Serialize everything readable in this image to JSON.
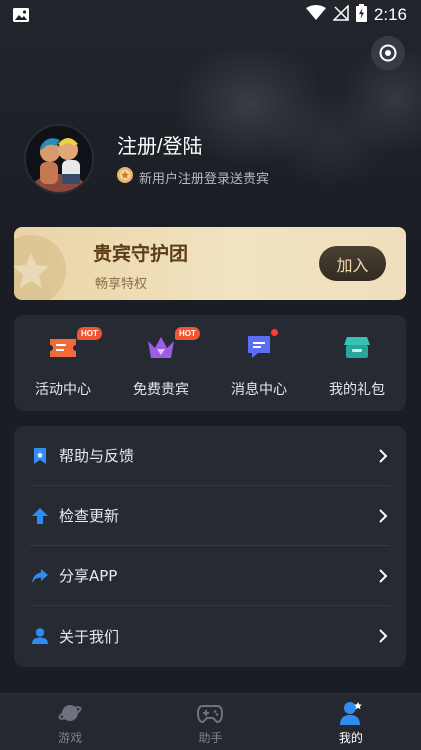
{
  "status_bar": {
    "time": "2:16"
  },
  "profile": {
    "name": "注册/登陆",
    "subtitle": "新用户注册登录送贵宾"
  },
  "vip": {
    "title": "贵宾守护团",
    "subtitle": "畅享特权",
    "join_label": "加入"
  },
  "quick": {
    "items": [
      {
        "label": "活动中心",
        "icon": "ticket-icon",
        "badge": "HOT"
      },
      {
        "label": "免费贵宾",
        "icon": "crown-icon",
        "badge": "HOT"
      },
      {
        "label": "消息中心",
        "icon": "message-icon"
      },
      {
        "label": "我的礼包",
        "icon": "gift-box-icon"
      }
    ]
  },
  "menu": {
    "items": [
      {
        "label": "帮助与反馈",
        "icon": "bookmark-icon"
      },
      {
        "label": "检查更新",
        "icon": "upload-arrow-icon"
      },
      {
        "label": "分享APP",
        "icon": "share-icon"
      },
      {
        "label": "关于我们",
        "icon": "user-icon"
      }
    ]
  },
  "bottom_nav": {
    "items": [
      {
        "label": "游戏",
        "icon": "planet-icon",
        "active": false
      },
      {
        "label": "助手",
        "icon": "gamepad-icon",
        "active": false
      },
      {
        "label": "我的",
        "icon": "profile-icon",
        "active": true
      }
    ]
  },
  "colors": {
    "background": "#1b1d24",
    "card": "#262a33",
    "vip_gold": "#efdfbc",
    "accent_blue": "#2f8cf0",
    "hot_badge": "#f2542d"
  }
}
